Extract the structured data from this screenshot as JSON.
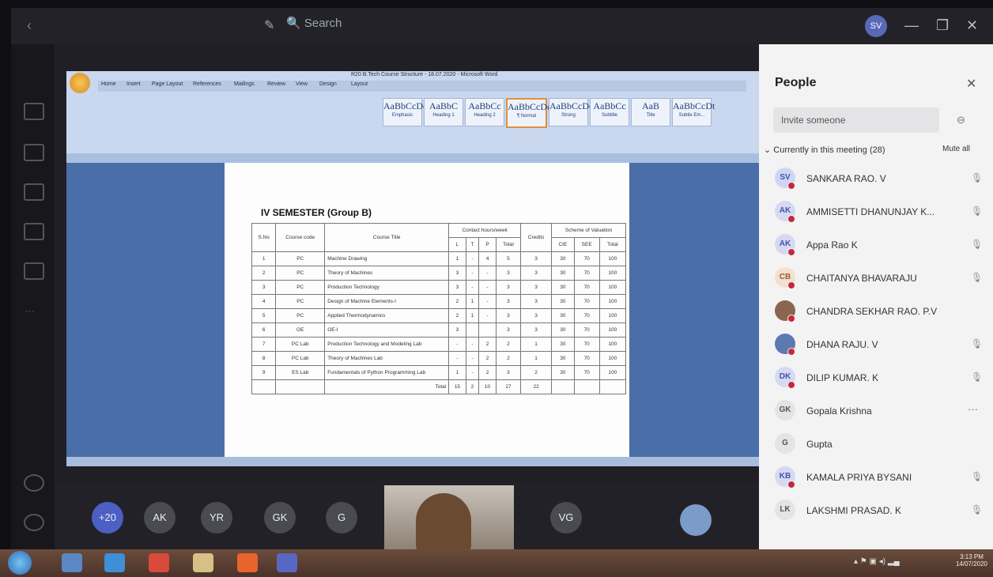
{
  "titlebar": {
    "search_placeholder": "Search",
    "avatar_initials": "SV"
  },
  "word": {
    "document_title": "R20 B.Tech Course Structure - 18.07.2020 - Microsoft Word",
    "tabs": [
      "Home",
      "Insert",
      "Page Layout",
      "References",
      "Mailings",
      "Review",
      "View",
      "Design",
      "Layout"
    ],
    "styles": [
      {
        "sample": "AaBbCcDc",
        "name": "Emphasis"
      },
      {
        "sample": "AaBbC",
        "name": "Heading 1"
      },
      {
        "sample": "AaBbCc",
        "name": "Heading 2"
      },
      {
        "sample": "AaBbCcDc",
        "name": "¶ Normal",
        "selected": true
      },
      {
        "sample": "AaBbCcDc",
        "name": "Strong"
      },
      {
        "sample": "AaBbCc",
        "name": "Subtitle"
      },
      {
        "sample": "AaB",
        "name": "Title"
      },
      {
        "sample": "AaBbCcDt",
        "name": "Subtle Em..."
      }
    ],
    "heading": "IV SEMESTER (Group B)",
    "table": {
      "header_top": [
        "S.No",
        "Course code",
        "Course Title",
        "Contact hours/week",
        "Credits",
        "Scheme of Valuation"
      ],
      "header_sub": [
        "L",
        "T",
        "P",
        "Total",
        "CIE",
        "SEE",
        "Total"
      ],
      "rows": [
        [
          "1",
          "PC",
          "Machine Drawing",
          "1",
          "-",
          "4",
          "5",
          "3",
          "30",
          "70",
          "100"
        ],
        [
          "2",
          "PC",
          "Theory of Machines",
          "3",
          "-",
          "-",
          "3",
          "3",
          "30",
          "70",
          "100"
        ],
        [
          "3",
          "PC",
          "Production Technology",
          "3",
          "-",
          "-",
          "3",
          "3",
          "30",
          "70",
          "100"
        ],
        [
          "4",
          "PC",
          "Design of Machine Elements-I",
          "2",
          "1",
          "-",
          "3",
          "3",
          "30",
          "70",
          "100"
        ],
        [
          "5",
          "PC",
          "Applied Thermodynamics",
          "2",
          "1",
          "-",
          "3",
          "3",
          "30",
          "70",
          "100"
        ],
        [
          "6",
          "OE",
          "OE-I",
          "3",
          "",
          "",
          "3",
          "3",
          "30",
          "70",
          "100"
        ],
        [
          "7",
          "PC Lab",
          "Production Technology and Modeling Lab",
          "-",
          "-",
          "2",
          "2",
          "1",
          "30",
          "70",
          "100"
        ],
        [
          "8",
          "PC Lab",
          "Theory of Machines Lab",
          "-",
          "-",
          "2",
          "2",
          "1",
          "30",
          "70",
          "100"
        ],
        [
          "9",
          "ES Lab",
          "Fundamentals of Python Programming Lab",
          "1",
          "-",
          "2",
          "3",
          "2",
          "30",
          "70",
          "100"
        ]
      ],
      "total_label": "Total",
      "totals": [
        "15",
        "2",
        "10",
        "27",
        "22"
      ]
    }
  },
  "people": {
    "title": "People",
    "invite_placeholder": "Invite someone",
    "section_label": "Currently in this meeting (28)",
    "mute_all": "Mute all",
    "participants": [
      {
        "initials": "SV",
        "name": "SANKARA RAO. V",
        "color": "#cfd6f5",
        "fg": "#4254a8"
      },
      {
        "initials": "AK",
        "name": "AMMISETTI DHANUNJAY K...",
        "color": "#d6d9f2",
        "fg": "#4254a8"
      },
      {
        "initials": "AK",
        "name": "Appa Rao K",
        "color": "#d6d9f2",
        "fg": "#4254a8"
      },
      {
        "initials": "CB",
        "name": "CHAITANYA BHAVARAJU",
        "color": "#f3e0d0",
        "fg": "#9a5a2a"
      },
      {
        "initials": "",
        "name": "CHANDRA SEKHAR RAO. P.V",
        "color": "#8a6650",
        "fg": "#fff"
      },
      {
        "initials": "",
        "name": "DHANA RAJU. V",
        "color": "#5c79b0",
        "fg": "#fff"
      },
      {
        "initials": "DK",
        "name": "DILIP KUMAR. K",
        "color": "#d6d9f2",
        "fg": "#4254a8"
      },
      {
        "initials": "GK",
        "name": "Gopala Krishna",
        "color": "#e4e4e4",
        "fg": "#555"
      },
      {
        "initials": "G",
        "name": "Gupta",
        "color": "#e4e4e4",
        "fg": "#555"
      },
      {
        "initials": "KB",
        "name": "KAMALA PRIYA BYSANI",
        "color": "#d6d9f2",
        "fg": "#4254a8"
      },
      {
        "initials": "LK",
        "name": "LAKSHMI PRASAD. K",
        "color": "#e4e4e4",
        "fg": "#555"
      }
    ]
  },
  "strip": {
    "circles": [
      {
        "label": "+20",
        "color": "#4b5fc4"
      },
      {
        "label": "AK",
        "color": "#4a4a52"
      },
      {
        "label": "YR",
        "color": "#4a4a52"
      },
      {
        "label": "GK",
        "color": "#4a4a52"
      },
      {
        "label": "G",
        "color": "#4a4a52"
      },
      {
        "label": "VG",
        "color": "#4a4a52"
      }
    ]
  },
  "taskbar": {
    "time": "3:13 PM",
    "date": "14/07/2020"
  }
}
